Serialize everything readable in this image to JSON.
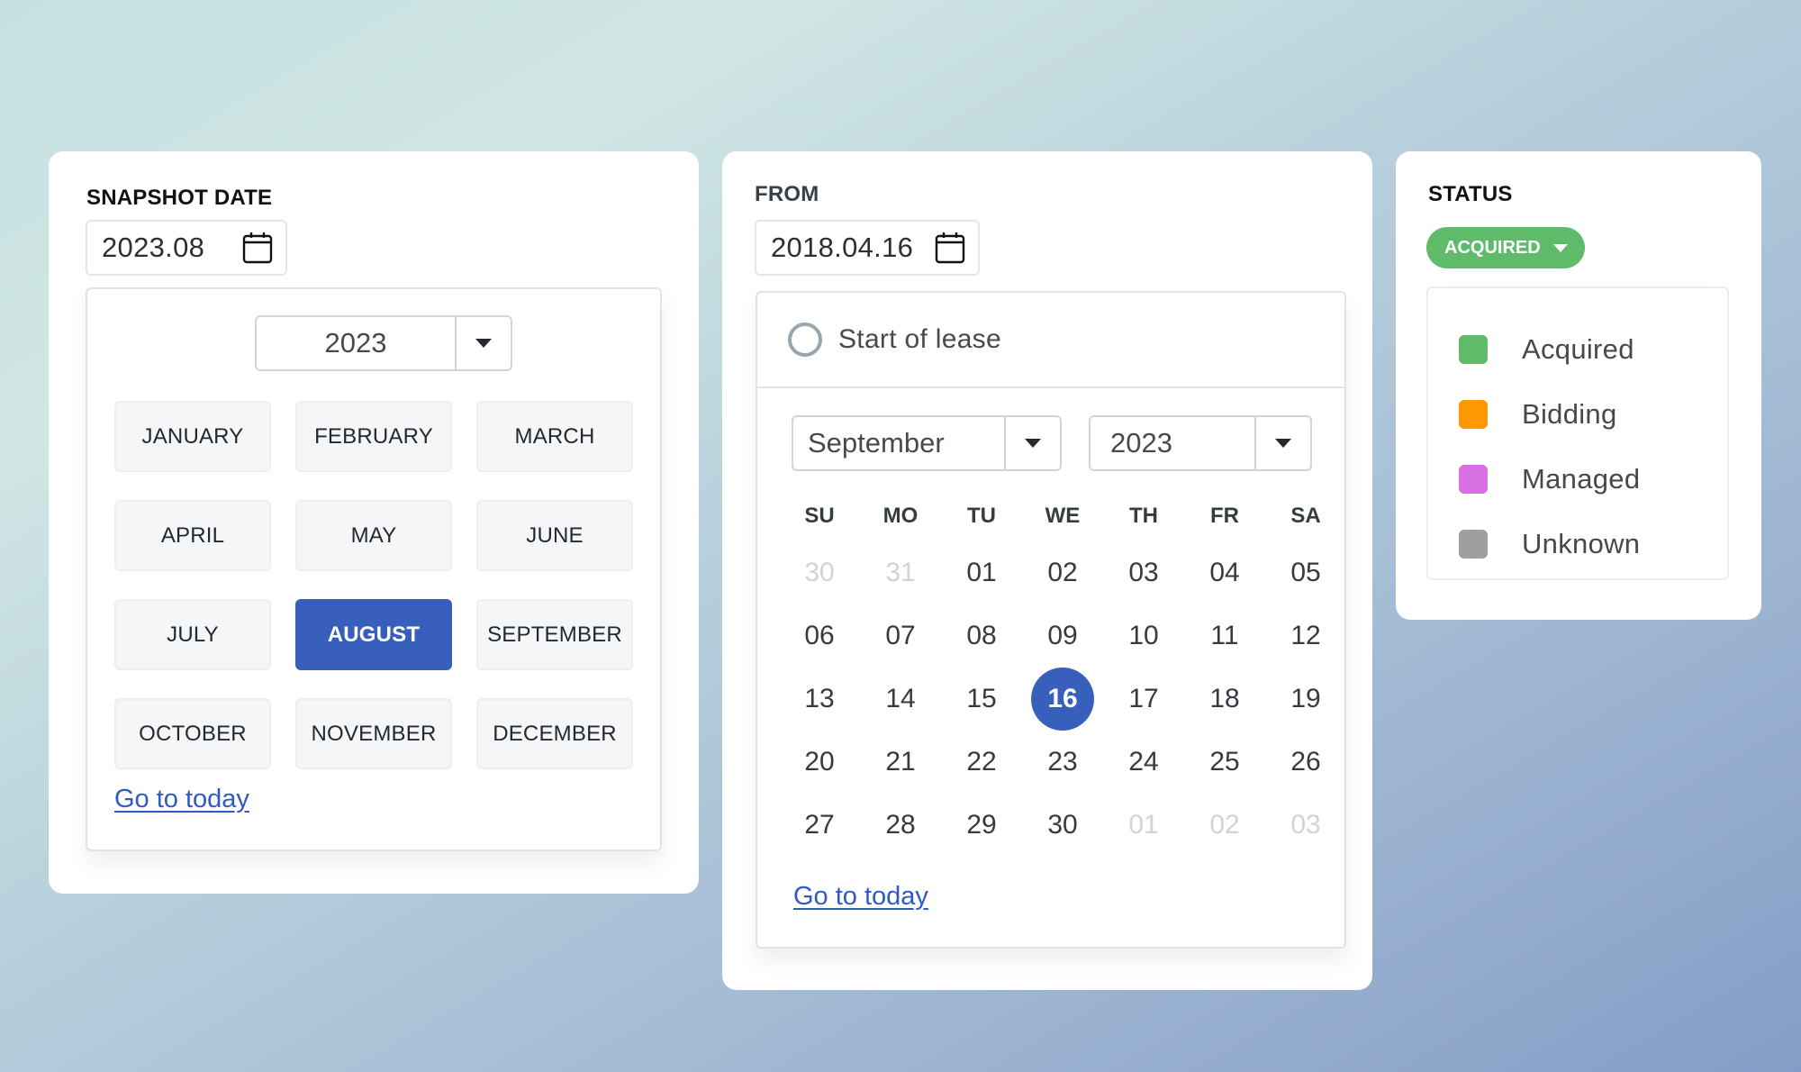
{
  "snapshot": {
    "label": "SNAPSHOT DATE",
    "input_value": "2023.08",
    "year_select": "2023",
    "months": [
      "JANUARY",
      "FEBRUARY",
      "MARCH",
      "APRIL",
      "MAY",
      "JUNE",
      "JULY",
      "AUGUST",
      "SEPTEMBER",
      "OCTOBER",
      "NOVEMBER",
      "DECEMBER"
    ],
    "selected_month": "AUGUST",
    "goto_today": "Go to today"
  },
  "from": {
    "label": "FROM",
    "input_value": "2018.04.16",
    "lease_option": "Start of lease",
    "month_select": "September",
    "year_select": "2023",
    "weekdays": [
      "SU",
      "MO",
      "TU",
      "WE",
      "TH",
      "FR",
      "SA"
    ],
    "days": [
      {
        "d": "30",
        "muted": true
      },
      {
        "d": "31",
        "muted": true
      },
      {
        "d": "01"
      },
      {
        "d": "02"
      },
      {
        "d": "03"
      },
      {
        "d": "04"
      },
      {
        "d": "05"
      },
      {
        "d": "06"
      },
      {
        "d": "07"
      },
      {
        "d": "08"
      },
      {
        "d": "09"
      },
      {
        "d": "10"
      },
      {
        "d": "11"
      },
      {
        "d": "12"
      },
      {
        "d": "13"
      },
      {
        "d": "14"
      },
      {
        "d": "15"
      },
      {
        "d": "16",
        "selected": true
      },
      {
        "d": "17"
      },
      {
        "d": "18"
      },
      {
        "d": "19"
      },
      {
        "d": "20"
      },
      {
        "d": "21"
      },
      {
        "d": "22"
      },
      {
        "d": "23"
      },
      {
        "d": "24"
      },
      {
        "d": "25"
      },
      {
        "d": "26"
      },
      {
        "d": "27"
      },
      {
        "d": "28"
      },
      {
        "d": "29"
      },
      {
        "d": "30"
      },
      {
        "d": "01",
        "muted": true
      },
      {
        "d": "02",
        "muted": true
      },
      {
        "d": "03",
        "muted": true
      }
    ],
    "goto_today": "Go to today"
  },
  "status": {
    "label": "STATUS",
    "selected": "ACQUIRED",
    "selected_color": "#5fbb6a",
    "options": [
      {
        "label": "Acquired",
        "color": "#5fbb6a"
      },
      {
        "label": "Bidding",
        "color": "#ff9800"
      },
      {
        "label": "Managed",
        "color": "#d870e4"
      },
      {
        "label": "Unknown",
        "color": "#9e9e9e"
      }
    ]
  },
  "colors": {
    "accent": "#385fbb",
    "link": "#2f5bbf"
  }
}
